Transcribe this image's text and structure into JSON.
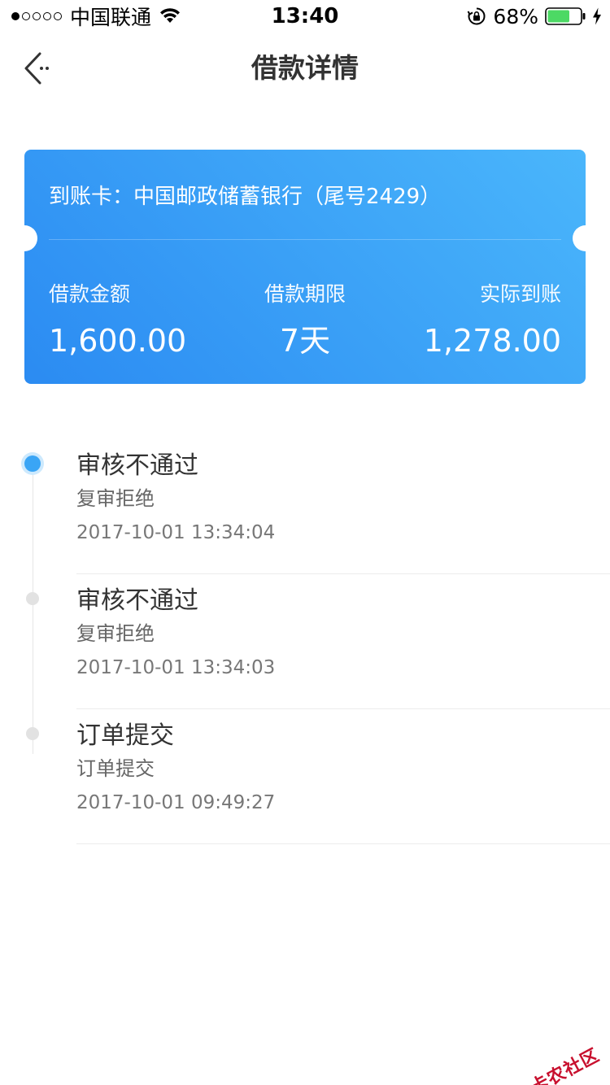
{
  "status_bar": {
    "carrier": "中国联通",
    "time": "13:40",
    "battery_percent": "68%",
    "battery_level": 0.68,
    "signal_bars_filled": 1,
    "signal_bars_total": 5
  },
  "nav": {
    "title": "借款详情",
    "back_icon": "chevron-left-dots-icon"
  },
  "loan_card": {
    "account_label": "到账卡：",
    "account_value": "中国邮政储蓄银行（尾号2429）",
    "amount_label": "借款金额",
    "amount_value": "1,600.00",
    "term_label": "借款期限",
    "term_value": "7天",
    "received_label": "实际到账",
    "received_value": "1,278.00",
    "gradient_start": "#2b8bf2",
    "gradient_end": "#4ab6fb"
  },
  "timeline": {
    "items": [
      {
        "title": "审核不通过",
        "subtitle": "复审拒绝",
        "time": "2017-10-01 13:34:04",
        "active": true
      },
      {
        "title": "审核不通过",
        "subtitle": "复审拒绝",
        "time": "2017-10-01 13:34:03",
        "active": false
      },
      {
        "title": "订单提交",
        "subtitle": "订单提交",
        "time": "2017-10-01 09:49:27",
        "active": false
      }
    ],
    "active_color": "#3aa5f5"
  },
  "watermark": {
    "text": "卡农社区"
  }
}
